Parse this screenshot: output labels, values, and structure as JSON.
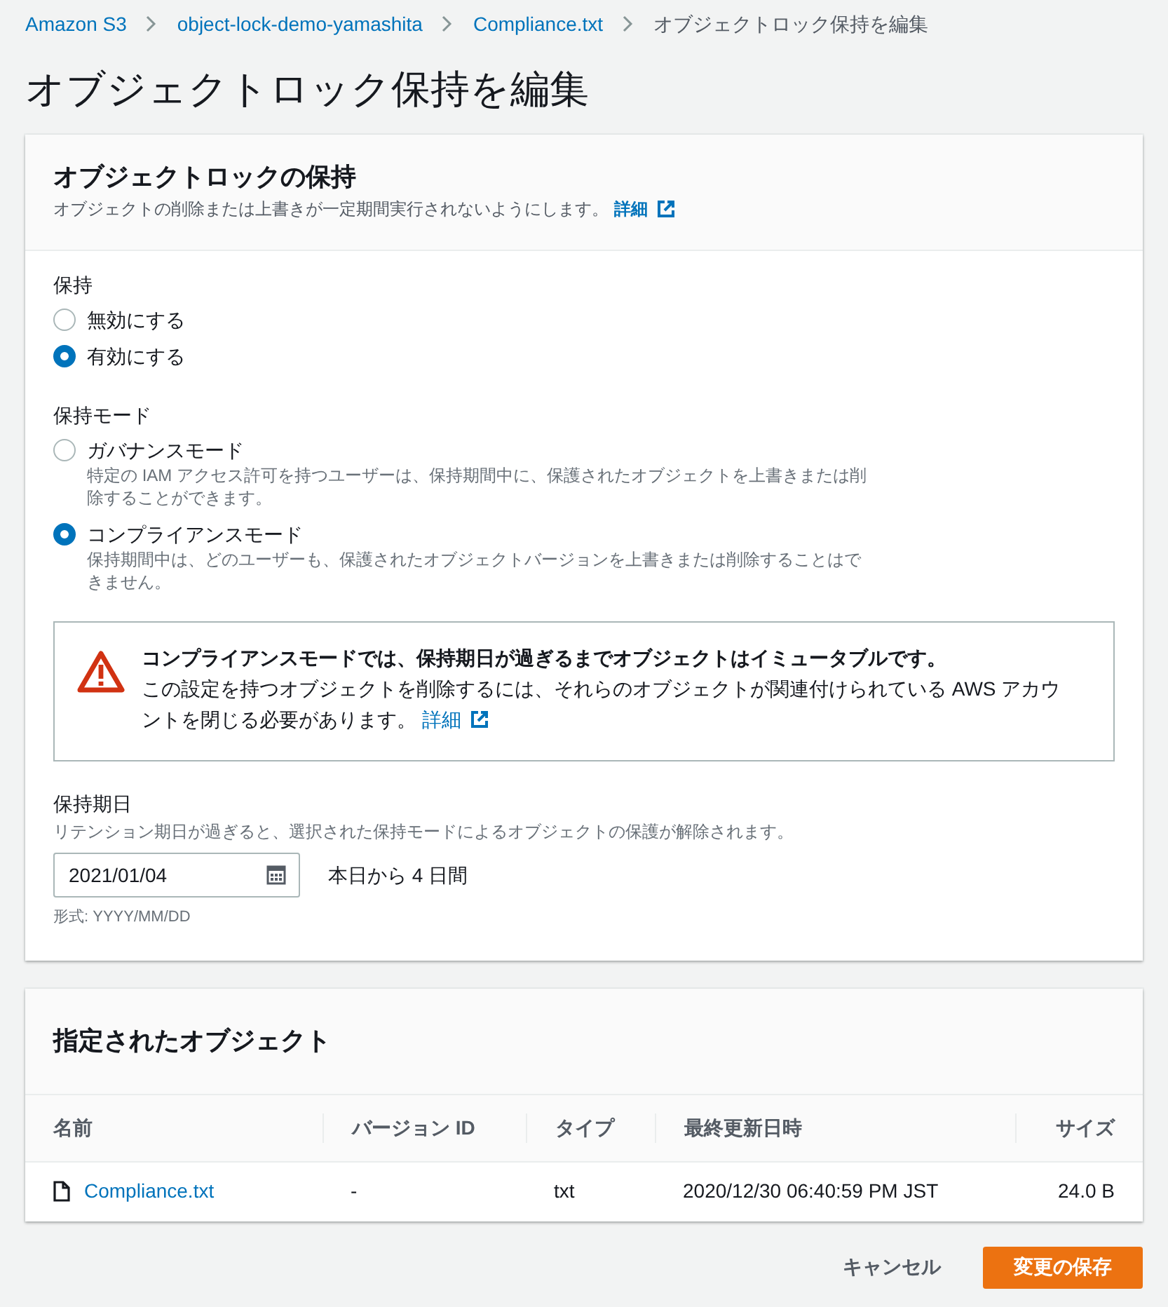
{
  "breadcrumbs": [
    {
      "label": "Amazon S3",
      "kind": "link"
    },
    {
      "label": "object-lock-demo-yamashita",
      "kind": "link"
    },
    {
      "label": "Compliance.txt",
      "kind": "link"
    },
    {
      "label": "オブジェクトロック保持を編集",
      "kind": "current"
    }
  ],
  "page_title": "オブジェクトロック保持を編集",
  "retention_panel": {
    "title": "オブジェクトロックの保持",
    "description": "オブジェクトの削除または上書きが一定期間実行されないようにします。",
    "info_link": "詳細",
    "retention": {
      "label": "保持",
      "options": [
        {
          "label": "無効にする",
          "selected": false
        },
        {
          "label": "有効にする",
          "selected": true
        }
      ]
    },
    "mode": {
      "label": "保持モード",
      "options": [
        {
          "label": "ガバナンスモード",
          "description": "特定の IAM アクセス許可を持つユーザーは、保持期間中に、保護されたオブジェクトを上書きまたは削除することができます。",
          "selected": false
        },
        {
          "label": "コンプライアンスモード",
          "description": "保持期間中は、どのユーザーも、保護されたオブジェクトバージョンを上書きまたは削除することはできません。",
          "selected": true
        }
      ]
    },
    "warning": {
      "title": "コンプライアンスモードでは、保持期日が過ぎるまでオブジェクトはイミュータブルです。",
      "body": "この設定を持つオブジェクトを削除するには、それらのオブジェクトが関連付けられている AWS アカウントを閉じる必要があります。",
      "link": "詳細"
    },
    "date_field": {
      "label": "保持期日",
      "description": "リテンション期日が過ぎると、選択された保持モードによるオブジェクトの保護が解除されます。",
      "value": "2021/01/04",
      "days_note": "本日から 4 日間",
      "format_hint": "形式: YYYY/MM/DD"
    }
  },
  "objects_panel": {
    "title": "指定されたオブジェクト",
    "columns": [
      "名前",
      "バージョン ID",
      "タイプ",
      "最終更新日時",
      "サイズ"
    ],
    "rows": [
      {
        "name": "Compliance.txt",
        "version_id": "-",
        "type": "txt",
        "last_modified": "2020/12/30 06:40:59 PM JST",
        "size": "24.0 B"
      }
    ]
  },
  "buttons": [
    {
      "label": "キャンセル",
      "kind": "secondary"
    },
    {
      "label": "変更の保存",
      "kind": "primary"
    }
  ]
}
